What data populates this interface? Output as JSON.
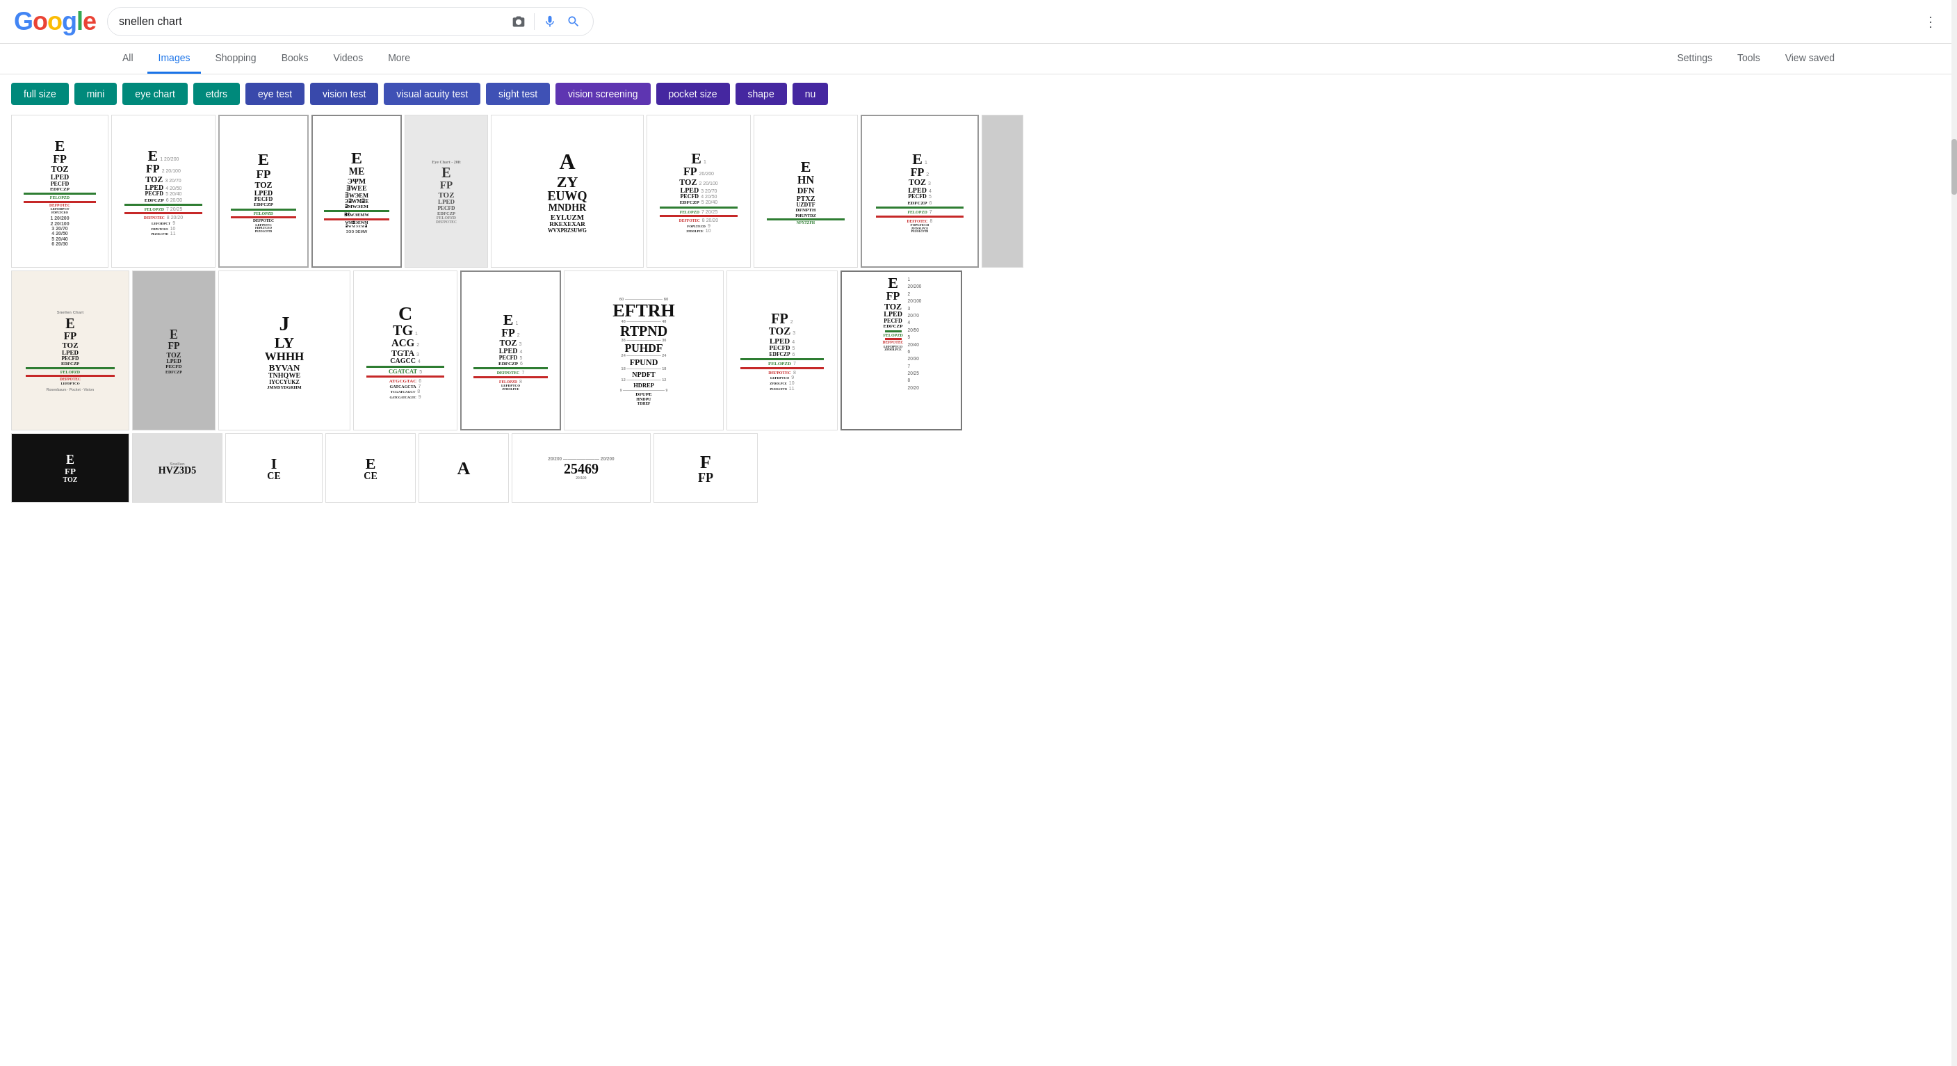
{
  "header": {
    "logo": "Google",
    "search_query": "snellen chart",
    "dots_icon": "⋮",
    "view_saved": "View saved"
  },
  "nav": {
    "items": [
      {
        "label": "All",
        "active": false
      },
      {
        "label": "Images",
        "active": true
      },
      {
        "label": "Shopping",
        "active": false
      },
      {
        "label": "Books",
        "active": false
      },
      {
        "label": "Videos",
        "active": false
      },
      {
        "label": "More",
        "active": false
      },
      {
        "label": "Settings",
        "active": false
      },
      {
        "label": "Tools",
        "active": false
      }
    ]
  },
  "chips": [
    {
      "label": "full size",
      "color": "teal"
    },
    {
      "label": "mini",
      "color": "teal"
    },
    {
      "label": "eye chart",
      "color": "teal"
    },
    {
      "label": "etdrs",
      "color": "teal"
    },
    {
      "label": "eye test",
      "color": "blue"
    },
    {
      "label": "vision test",
      "color": "blue"
    },
    {
      "label": "visual acuity test",
      "color": "indigo"
    },
    {
      "label": "sight test",
      "color": "indigo"
    },
    {
      "label": "vision screening",
      "color": "purple"
    },
    {
      "label": "pocket size",
      "color": "deep-purple"
    },
    {
      "label": "shape",
      "color": "deep-purple"
    },
    {
      "label": "nu",
      "color": "deep-purple"
    }
  ],
  "colors": {
    "teal": "#00897B",
    "blue": "#3949AB",
    "indigo": "#3F51B5",
    "purple": "#5E35B1",
    "deep-purple": "#4527A0"
  }
}
